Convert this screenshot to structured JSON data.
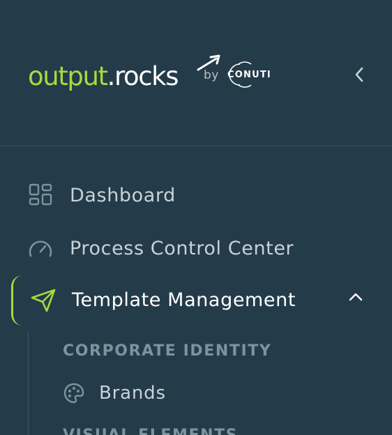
{
  "brand": {
    "logo_primary": "output",
    "logo_secondary": ".rocks",
    "by_label": "by",
    "partner_logo": "CONUTI",
    "accent_color": "#a7d93f",
    "background_color": "#243b4a"
  },
  "header": {
    "collapse_icon": "chevron-left-icon"
  },
  "nav": {
    "items": [
      {
        "label": "Dashboard",
        "icon": "dashboard-grid-icon"
      },
      {
        "label": "Process Control Center",
        "icon": "gauge-icon"
      },
      {
        "label": "Template Management",
        "icon": "send-icon",
        "active": true,
        "expanded": true
      }
    ]
  },
  "submenu": {
    "section_heading": "CORPORATE IDENTITY",
    "items": [
      {
        "label": "Brands",
        "icon": "palette-icon"
      }
    ],
    "next_heading_partial": "VISUAL ELEMENTS"
  }
}
